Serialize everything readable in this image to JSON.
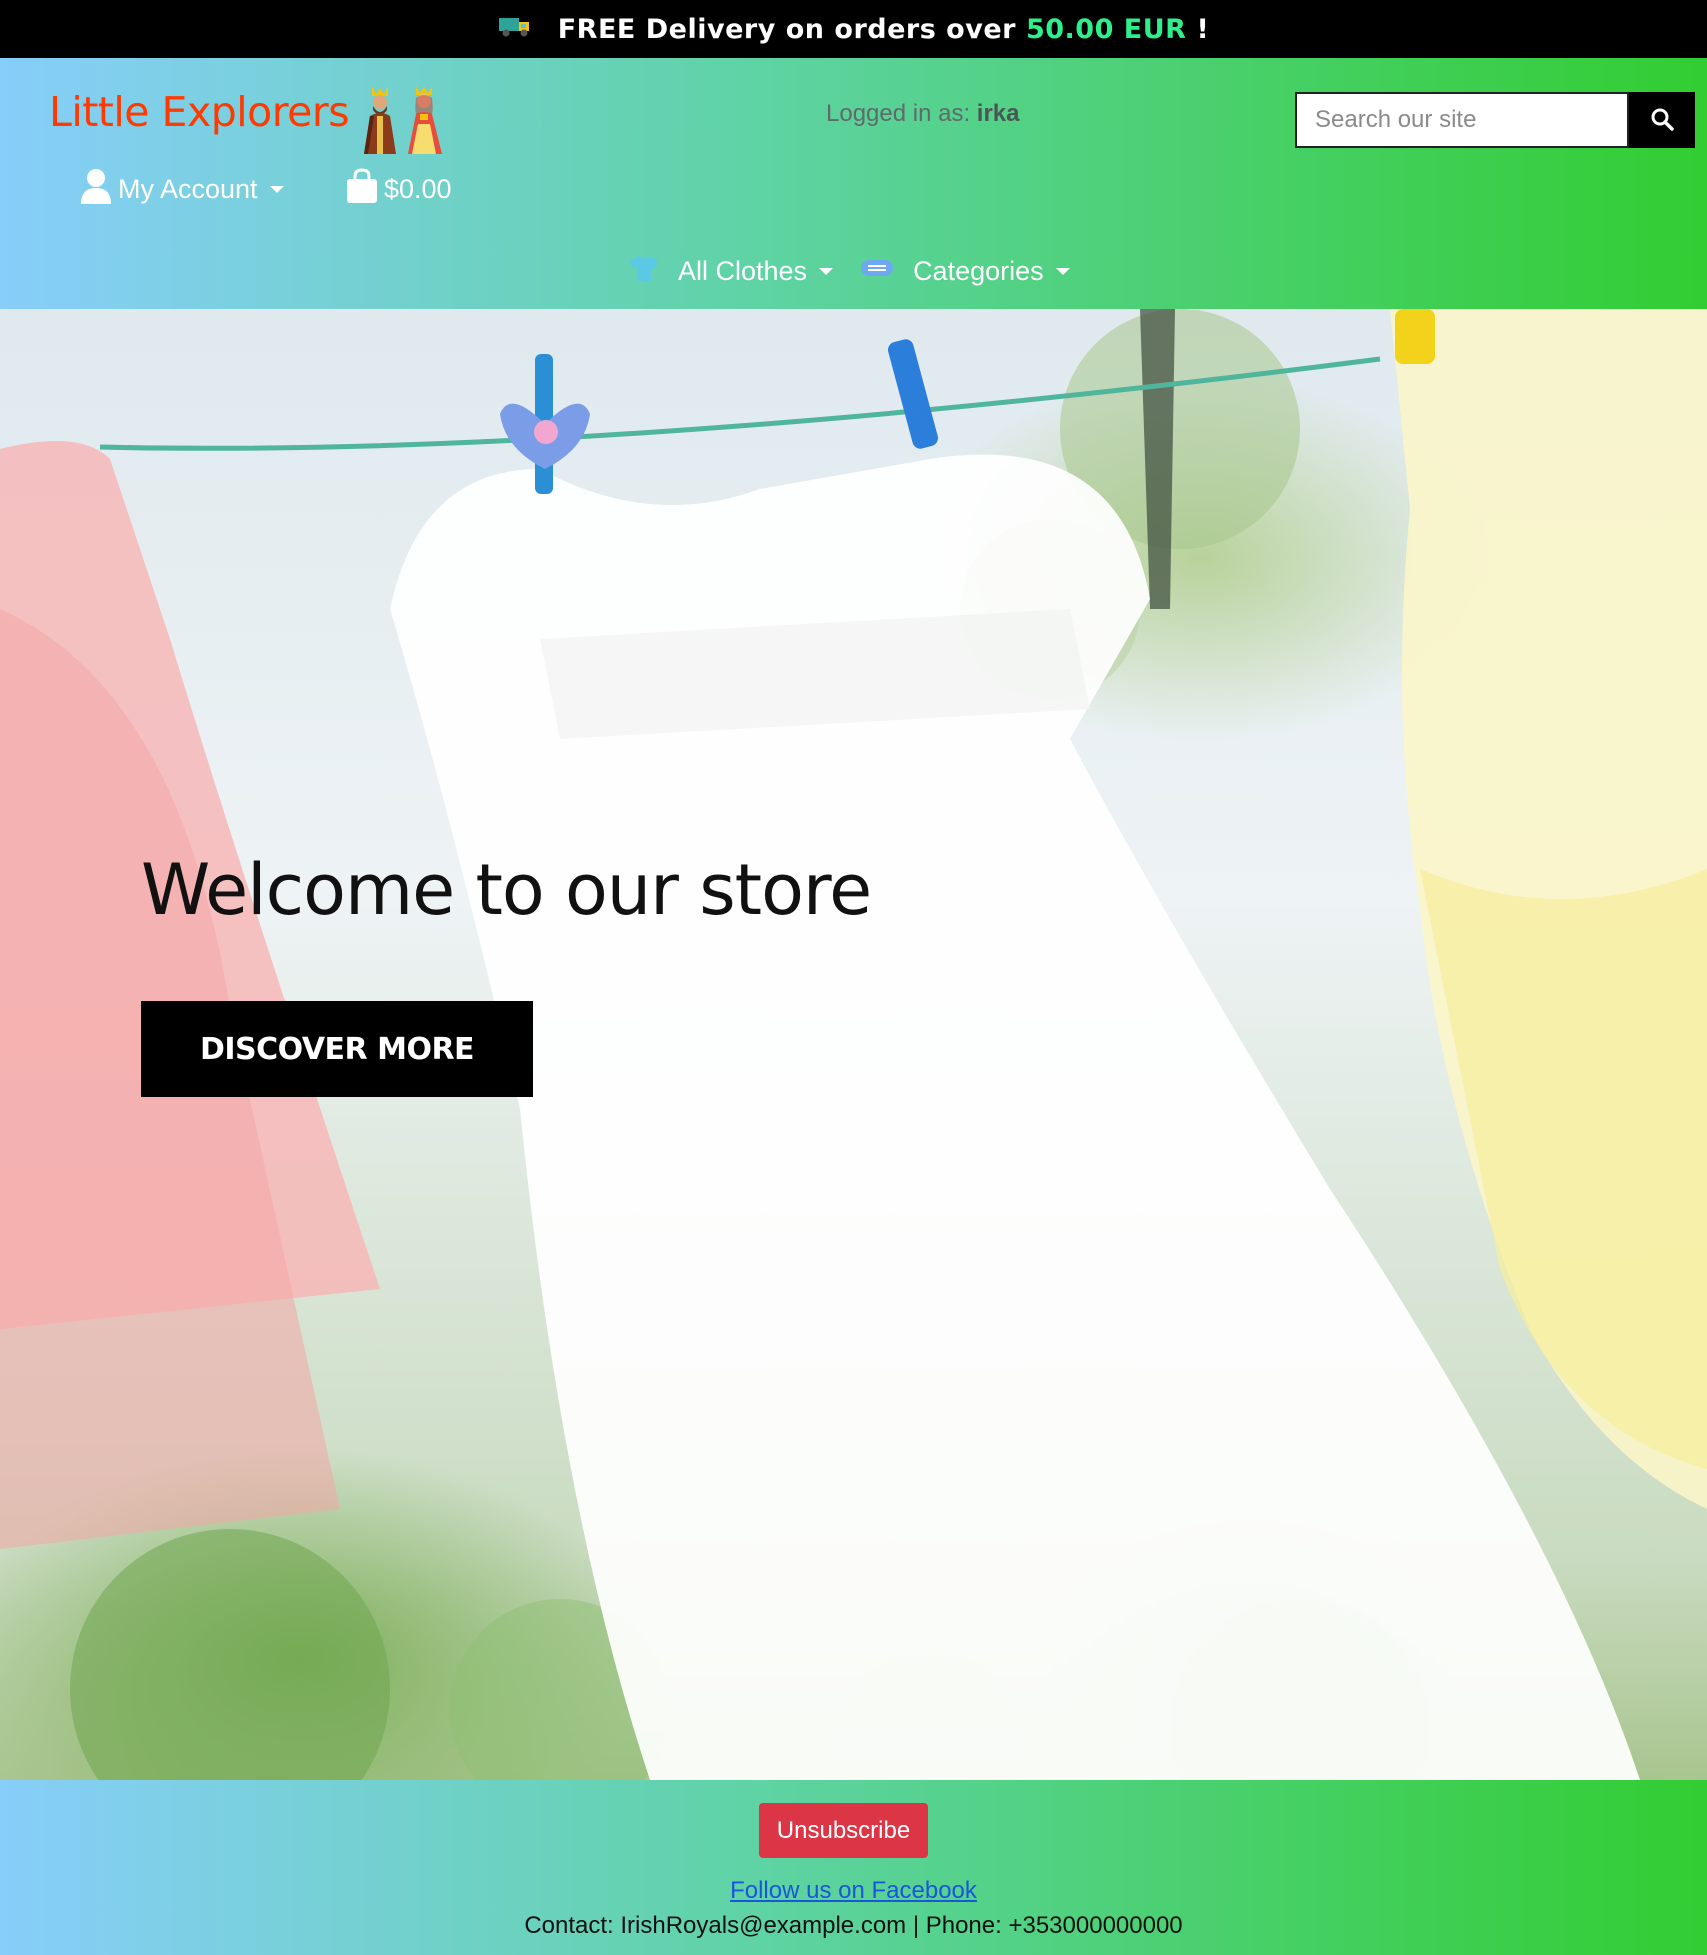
{
  "banner": {
    "prefix": "FREE Delivery on orders over",
    "amount": "50.00 EUR",
    "suffix": "!",
    "icon": "truck-icon"
  },
  "header": {
    "brand": "Little Explorers",
    "logged_label": "Logged in as:",
    "logged_user": "irka",
    "search_placeholder": "Search our site",
    "account_label": "My Account",
    "bag_total": "$0.00",
    "nav": [
      {
        "label": "All Clothes",
        "icon": "tshirt-icon"
      },
      {
        "label": "Categories",
        "icon": "mask-icon"
      }
    ]
  },
  "hero": {
    "title": "Welcome to our store",
    "button": "DISCOVER MORE"
  },
  "footer": {
    "unsubscribe": "Unsubscribe",
    "facebook": "Follow us on Facebook",
    "contact": "Contact: IrishRoyals@example.com | Phone: +353000000000"
  },
  "colors": {
    "brand": "#ff3a00",
    "amount": "#2ef08a",
    "gradient_start": "#87cefa",
    "gradient_end": "#32cd32",
    "unsubscribe": "#dc3545"
  }
}
